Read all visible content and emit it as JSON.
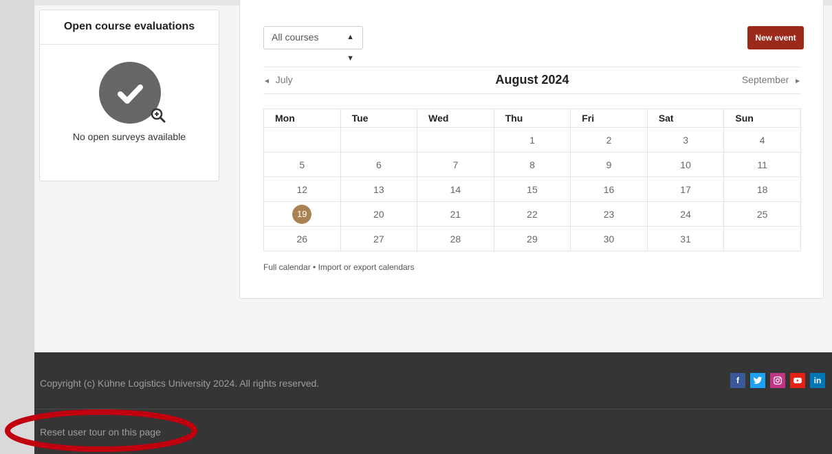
{
  "evaluations": {
    "title": "Open course evaluations",
    "empty_text": "No open surveys available"
  },
  "calendar": {
    "course_select": "All courses",
    "new_event_label": "New event",
    "prev_month": "July",
    "current_month": "August 2024",
    "next_month": "September",
    "weekdays": [
      "Mon",
      "Tue",
      "Wed",
      "Thu",
      "Fri",
      "Sat",
      "Sun"
    ],
    "weeks": [
      [
        "",
        "",
        "",
        "1",
        "2",
        "3",
        "4"
      ],
      [
        "5",
        "6",
        "7",
        "8",
        "9",
        "10",
        "11"
      ],
      [
        "12",
        "13",
        "14",
        "15",
        "16",
        "17",
        "18"
      ],
      [
        "19",
        "20",
        "21",
        "22",
        "23",
        "24",
        "25"
      ],
      [
        "26",
        "27",
        "28",
        "29",
        "30",
        "31",
        ""
      ]
    ],
    "today": "19",
    "full_calendar_link": "Full calendar",
    "separator": "•",
    "import_export_link": "Import or export calendars"
  },
  "footer": {
    "copyright": "Copyright (c) Kühne Logistics University 2024. All rights reserved.",
    "reset_tour": "Reset user tour on this page",
    "social": [
      {
        "icon": "facebook-icon",
        "glyph": "f",
        "color": "#3b5998"
      },
      {
        "icon": "twitter-icon",
        "glyph": "t",
        "color": "#1da1f2"
      },
      {
        "icon": "instagram-icon",
        "glyph": "◎",
        "color": "#c13584"
      },
      {
        "icon": "youtube-icon",
        "glyph": "▶",
        "color": "#e62117"
      },
      {
        "icon": "linkedin-icon",
        "glyph": "in",
        "color": "#0077b5"
      }
    ]
  },
  "colors": {
    "accent_button": "#9b2a1a",
    "today_badge": "#a88253",
    "annotation": "#c0000e"
  }
}
